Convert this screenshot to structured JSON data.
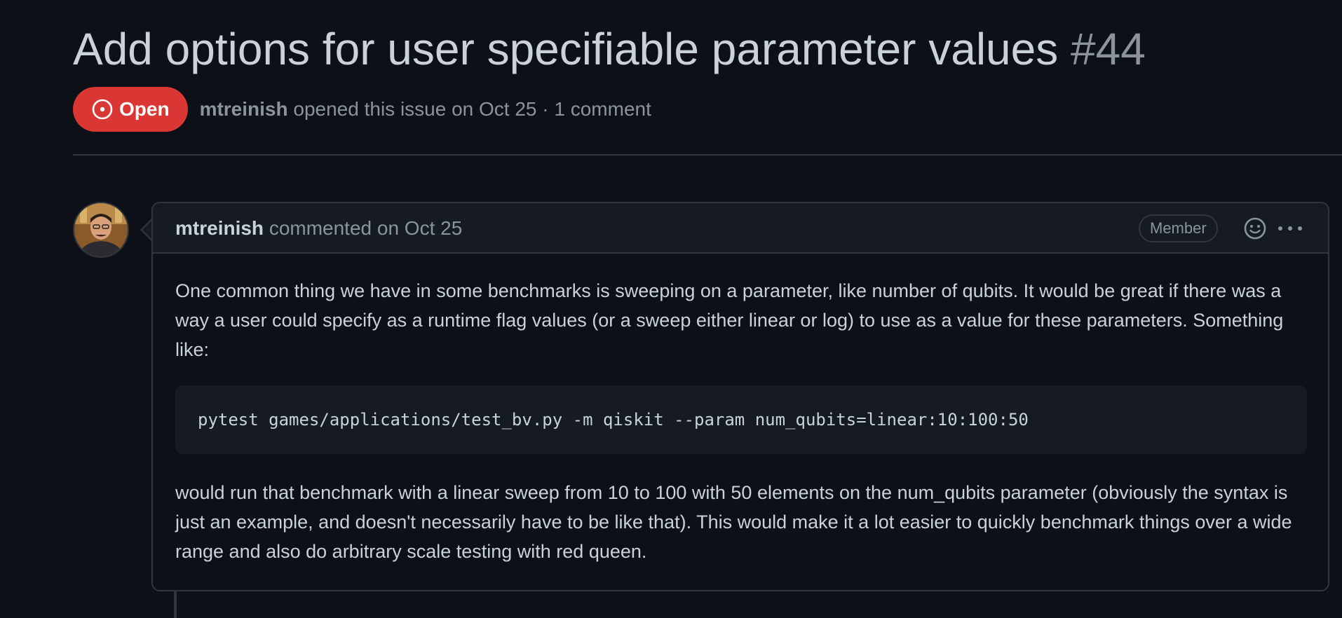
{
  "issue": {
    "title": "Add options for user specifiable parameter values",
    "number": "#44",
    "state": "Open",
    "author": "mtreinish",
    "meta_text": "opened this issue on Oct 25 · 1 comment"
  },
  "comment": {
    "author": "mtreinish",
    "action_text": "commented on Oct 25",
    "role_badge": "Member",
    "body_paragraph_1": "One common thing we have in some benchmarks is sweeping on a parameter, like number of qubits. It would be great if there was a way a user could specify as a runtime flag values (or a sweep either linear or log) to use as a value for these parameters. Something like:",
    "code": "pytest games/applications/test_bv.py -m qiskit --param num_qubits=linear:10:100:50",
    "body_paragraph_2": "would run that benchmark with a linear sweep from 10 to 100 with 50 elements on the num_qubits parameter (obviously the syntax is just an example, and doesn't necessarily have to be like that). This would make it a lot easier to quickly benchmark things over a wide range and also do arbitrary scale testing with red queen."
  },
  "icons": {
    "state": "issue-opened-icon",
    "reaction": "smiley-icon",
    "menu": "kebab-horizontal-icon"
  },
  "colors": {
    "background": "#0d1117",
    "open_badge": "#da3633",
    "border": "#30363d",
    "header_bg": "#161b22",
    "muted_text": "#8b949e",
    "primary_text": "#c9d1d9"
  }
}
